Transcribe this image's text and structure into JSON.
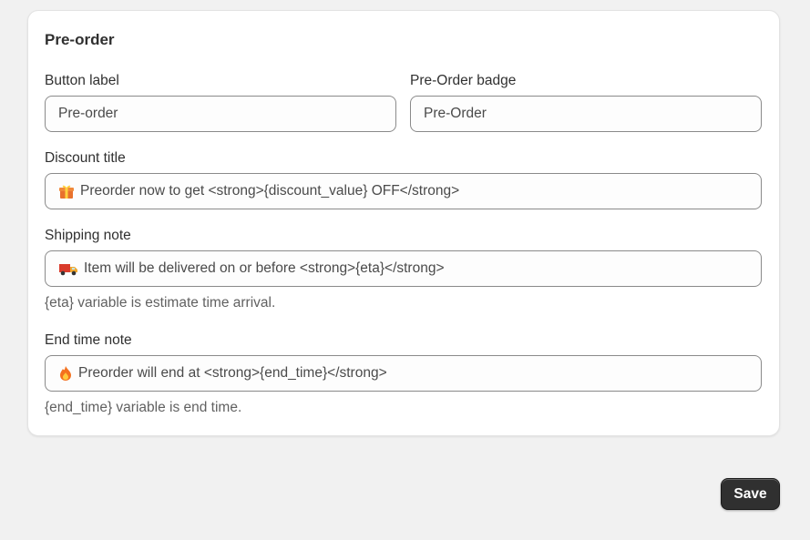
{
  "card": {
    "title": "Pre-order"
  },
  "fields": {
    "button_label": {
      "label": "Button label",
      "value": "Pre-order"
    },
    "badge": {
      "label": "Pre-Order badge",
      "value": "Pre-Order"
    },
    "discount_title": {
      "label": "Discount title",
      "icon": "gift-icon",
      "value": "Preorder now to get <strong>{discount_value} OFF</strong>"
    },
    "shipping_note": {
      "label": "Shipping note",
      "icon": "delivery-truck-icon",
      "value": "Item will be delivered on or before <strong>{eta}</strong>",
      "help": "{eta} variable is estimate time arrival."
    },
    "end_time_note": {
      "label": "End time note",
      "icon": "fire-icon",
      "value": "Preorder will end at <strong>{end_time}</strong>",
      "help": "{end_time} variable is end time."
    }
  },
  "actions": {
    "save_label": "Save"
  },
  "colors": {
    "page_bg": "#f1f1f1",
    "card_bg": "#ffffff",
    "input_border": "#8a8a8a",
    "save_bg": "#303030"
  }
}
